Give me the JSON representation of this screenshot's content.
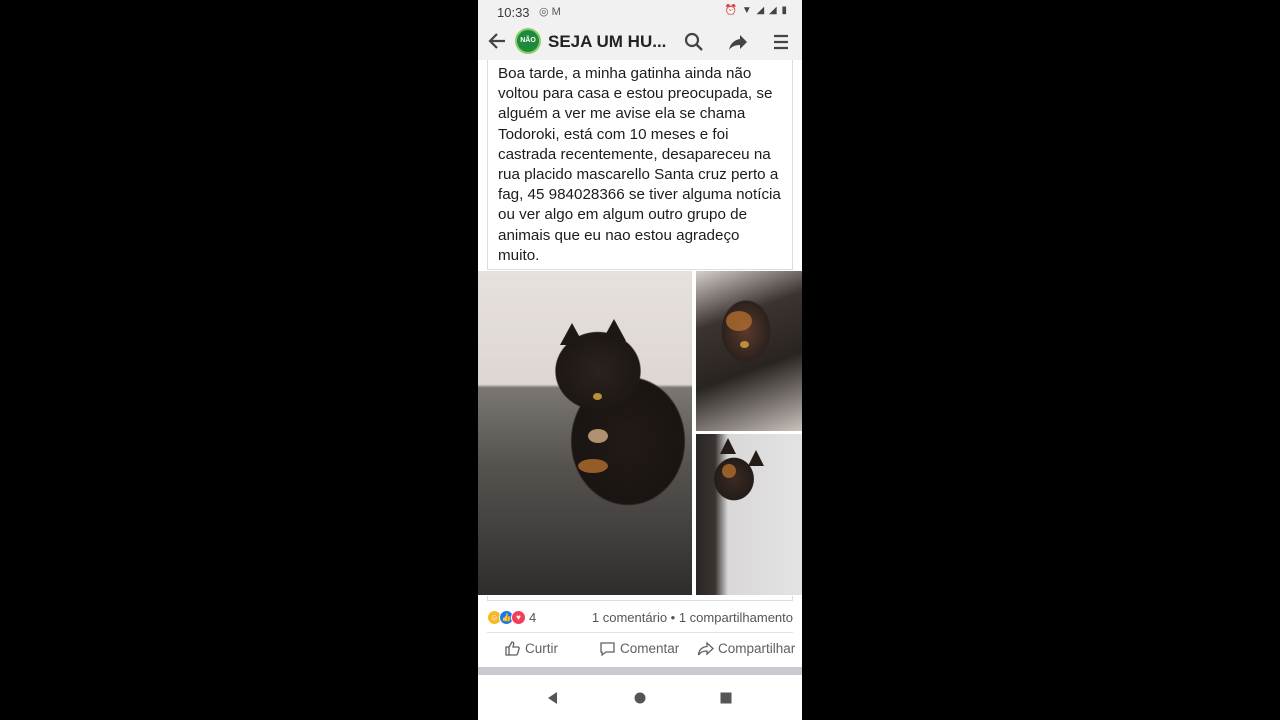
{
  "status_bar": {
    "time": "10:33",
    "left_icons": [
      "whatsapp-icon",
      "gmail-icon"
    ],
    "right_icons": [
      "alarm-icon",
      "wifi-icon",
      "signal-icon",
      "signal-icon",
      "battery-icon"
    ]
  },
  "app_bar": {
    "title": "SEJA UM HU...",
    "logo_text": "NÃO"
  },
  "post": {
    "text": "Boa tarde, a minha gatinha ainda não voltou para casa e estou preocupada, se alguém a ver me avise ela se chama Todoroki, está com 10 meses e foi castrada recentemente, desapareceu na rua placido mascarello Santa cruz perto a fag, 45 984028366 se tiver alguma notícia ou ver algo em algum outro grupo de animais que eu nao estou agradeço muito.",
    "photos": [
      "cat-photo-1",
      "cat-photo-2",
      "cat-photo-3"
    ]
  },
  "reactions": {
    "count": "4",
    "stats": "1 comentário • 1 compartilhamento",
    "colors": {
      "care": "#f7b928",
      "like": "#1877f2",
      "love": "#f33e58"
    }
  },
  "actions": {
    "like": "Curtir",
    "comment": "Comentar",
    "share": "Compartilhar"
  }
}
